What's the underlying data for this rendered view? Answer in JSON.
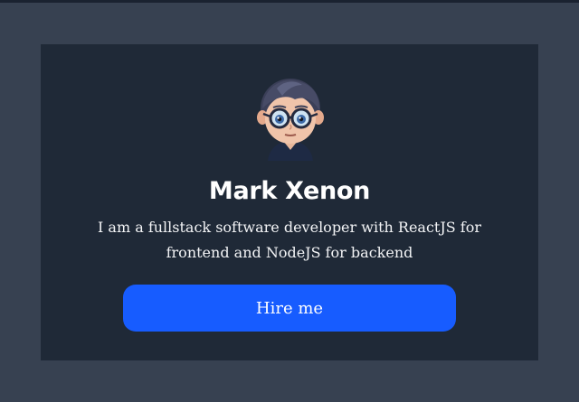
{
  "profile": {
    "avatar_icon": "avatar-cartoon-boy-glasses",
    "name": "Mark Xenon",
    "bio": "I am a fullstack software developer with ReactJS for frontend and NodeJS for backend",
    "hire_label": "Hire me"
  },
  "colors": {
    "page_bg": "#374151",
    "card_bg": "#1f2937",
    "button_bg": "#175cff",
    "text": "#ffffff"
  }
}
